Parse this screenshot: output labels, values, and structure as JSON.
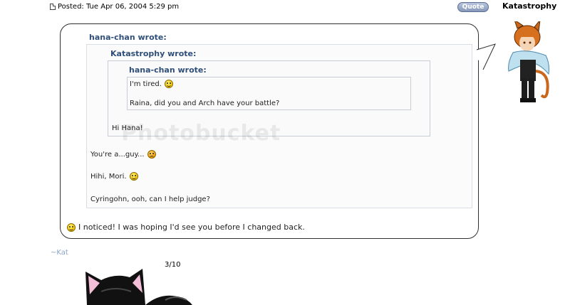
{
  "post": {
    "posted_label": "Posted: Tue Apr 06, 2004 5:29 pm",
    "quote_button": "Quote",
    "author": "Katastrophy"
  },
  "quotes": {
    "outer_author": "hana-chan wrote:",
    "mid_author": "Katastrophy wrote:",
    "inner_author": "hana-chan wrote:",
    "inner_line1": "I'm tired.",
    "inner_line2": "Raina, did you and Arch have your battle?",
    "mid_line1": "Hi Hana!",
    "outer_line1": "You're a...guy...",
    "outer_line2": "Hihi, Mori.",
    "outer_line3": "Cyringohn, ooh, can I help judge?"
  },
  "reply": {
    "text": "I noticed! I was hoping I'd see you before I changed back."
  },
  "signature": {
    "name": "~Kat",
    "counter": "3/10"
  },
  "watermark": "Photobucket",
  "colors": {
    "quote_author": "#2f4f78",
    "signature": "#8da6c4",
    "quote_button": "#8797b9"
  },
  "icons": [
    "post-icon",
    "smiley-icon",
    "sad-smiley-icon"
  ]
}
